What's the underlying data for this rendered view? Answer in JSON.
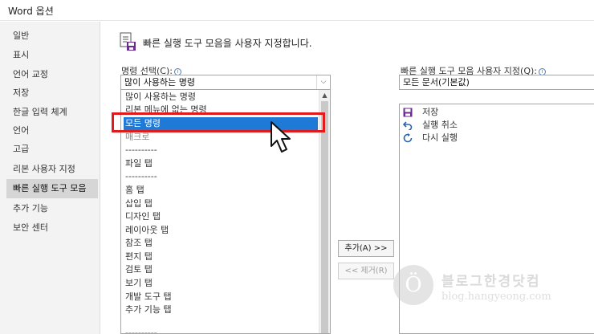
{
  "window": {
    "title": "Word 옵션"
  },
  "sidebar": {
    "items": [
      {
        "label": "일반"
      },
      {
        "label": "표시"
      },
      {
        "label": "언어 교정"
      },
      {
        "label": "저장"
      },
      {
        "label": "한글 입력 체계"
      },
      {
        "label": "언어"
      },
      {
        "label": "고급"
      },
      {
        "label": "리본 사용자 지정"
      },
      {
        "label": "빠른 실행 도구 모음",
        "active": true
      },
      {
        "label": "추가 기능"
      },
      {
        "label": "보안 센터"
      }
    ]
  },
  "header": {
    "title": "빠른 실행 도구 모음을 사용자 지정합니다."
  },
  "commands": {
    "label": "명령 선택(C):",
    "info_icon": "info-icon",
    "selected_value": "많이 사용하는 명령",
    "dropdown_icon": "chevron-down-icon",
    "list": [
      "많이 사용하는 명령",
      "리본 메뉴에 없는 명령",
      "모든 명령",
      "매크로",
      "----------",
      "파일 탭",
      "----------",
      "홈 탭",
      "삽입 탭",
      "디자인 탭",
      "레이아웃 탭",
      "참조 탭",
      "편지 탭",
      "검토 탭",
      "보기 탭",
      "개발 도구 탭",
      "추가 기능 탭",
      "----------"
    ],
    "selected_index": 2
  },
  "buttons": {
    "add": "추가(A) >>",
    "remove": "<< 제거(R)"
  },
  "qat": {
    "label": "빠른 실행 도구 모음 사용자 지정(Q):",
    "info_icon": "info-icon",
    "selected_value": "모든 문서(기본값)",
    "items": [
      {
        "label": "저장",
        "icon": "save-icon"
      },
      {
        "label": "실행 취소",
        "icon": "undo-icon"
      },
      {
        "label": "다시 실행",
        "icon": "redo-icon"
      }
    ]
  },
  "watermark": {
    "title": "블로그한경닷컴",
    "subtitle": "blog.hangyeong.com"
  },
  "colors": {
    "selection": "#1e7ad6",
    "highlight": "#e11b1b",
    "accent": "#4a7fc1"
  }
}
